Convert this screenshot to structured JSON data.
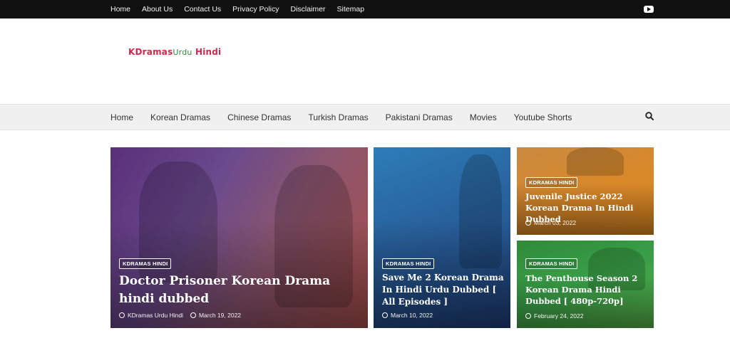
{
  "top_links": [
    "Home",
    "About Us",
    "Contact Us",
    "Privacy Policy",
    "Disclaimer",
    "Sitemap"
  ],
  "logo": {
    "part1": "KDramas",
    "part2": "Urdu",
    "part3": "Hindi"
  },
  "nav_links": [
    "Home",
    "Korean Dramas",
    "Chinese Dramas",
    "Turkish Dramas",
    "Pakistani Dramas",
    "Movies",
    "Youtube Shorts"
  ],
  "posts": [
    {
      "badge": "KDRAMAS HINDI",
      "title": "Doctor Prisoner Korean Drama hindi dubbed",
      "author": "KDramas Urdu Hindi",
      "date": "March 19, 2022"
    },
    {
      "badge": "KDRAMAS HINDI",
      "title": "Save Me 2 Korean Drama In Hindi Urdu Dubbed [ All Episodes ]",
      "date": "March 10, 2022"
    },
    {
      "badge": "KDRAMAS HINDI",
      "title": "Juvenile Justice 2022 Korean Drama In Hindi Dubbed",
      "date": "March 03, 2022"
    },
    {
      "badge": "KDRAMAS HINDI",
      "title": "The Penthouse Season 2 Korean Drama Hindi Dubbed [ 480p-720p]",
      "date": "February 24, 2022"
    }
  ],
  "icons": {
    "youtube": "youtube-icon",
    "search": "search-icon",
    "user": "user-icon",
    "clock": "clock-icon"
  }
}
